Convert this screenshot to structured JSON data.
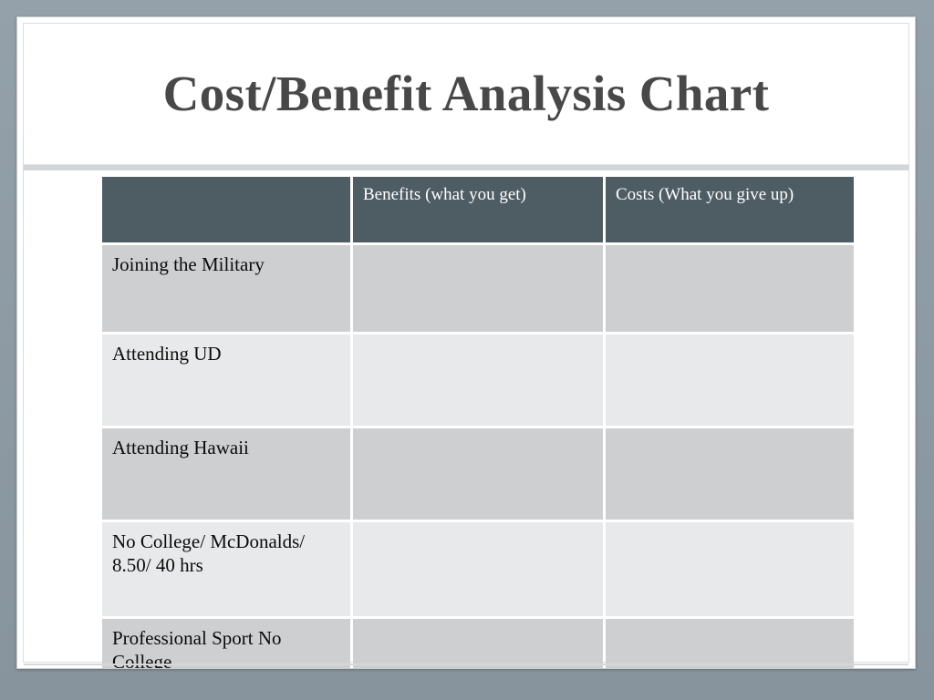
{
  "slide": {
    "title": "Cost/Benefit Analysis Chart"
  },
  "table": {
    "columns": [
      {
        "key": "item",
        "label": ""
      },
      {
        "key": "benefits",
        "label": "Benefits (what you get)"
      },
      {
        "key": "costs",
        "label": "Costs (What you give up)"
      }
    ],
    "rows": [
      {
        "item": "Joining the Military",
        "benefits": "",
        "costs": ""
      },
      {
        "item": "Attending UD",
        "benefits": "",
        "costs": ""
      },
      {
        "item": "Attending Hawaii",
        "benefits": "",
        "costs": ""
      },
      {
        "item": "No College/ McDonalds/ 8.50/ 40 hrs",
        "benefits": "",
        "costs": ""
      },
      {
        "item": "Professional Sport No College",
        "benefits": "",
        "costs": ""
      }
    ]
  },
  "colors": {
    "background": "#8e9ca6",
    "slide": "#ffffff",
    "header_fill": "#4e5c63",
    "header_text": "#ffffff",
    "row_dark": "#cdcfd1",
    "row_light": "#e8e9ea",
    "title_text": "#484848",
    "divider": "#d2d6d9"
  }
}
